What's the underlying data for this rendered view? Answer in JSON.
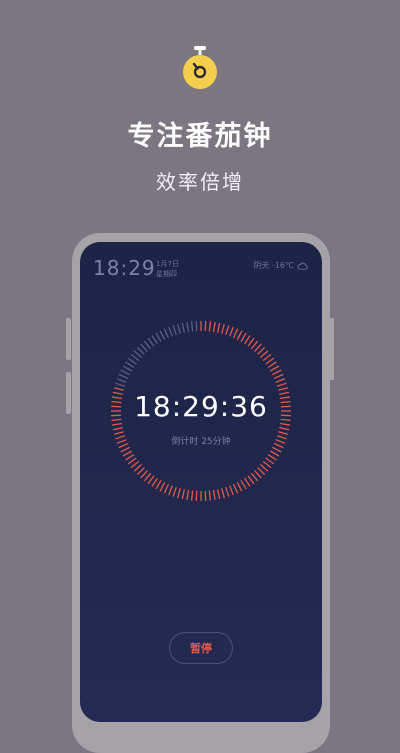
{
  "hero": {
    "title": "专注番茄钟",
    "subtitle": "效率倍增"
  },
  "status_bar": {
    "time": "18:29",
    "date": "1月7日",
    "weekday": "星期四",
    "weather": "阴天 -16℃",
    "weather_icon": "cloud-icon"
  },
  "timer": {
    "time": "18:29:36",
    "countdown_label": "倒计时 25分钟",
    "progress_fraction": 0.8
  },
  "controls": {
    "pause_label": "暂停"
  },
  "colors": {
    "background": "#7b7680",
    "icon_yellow": "#f2d04d",
    "accent_red": "#e05a4a",
    "screen_bg": "#1e2446"
  }
}
